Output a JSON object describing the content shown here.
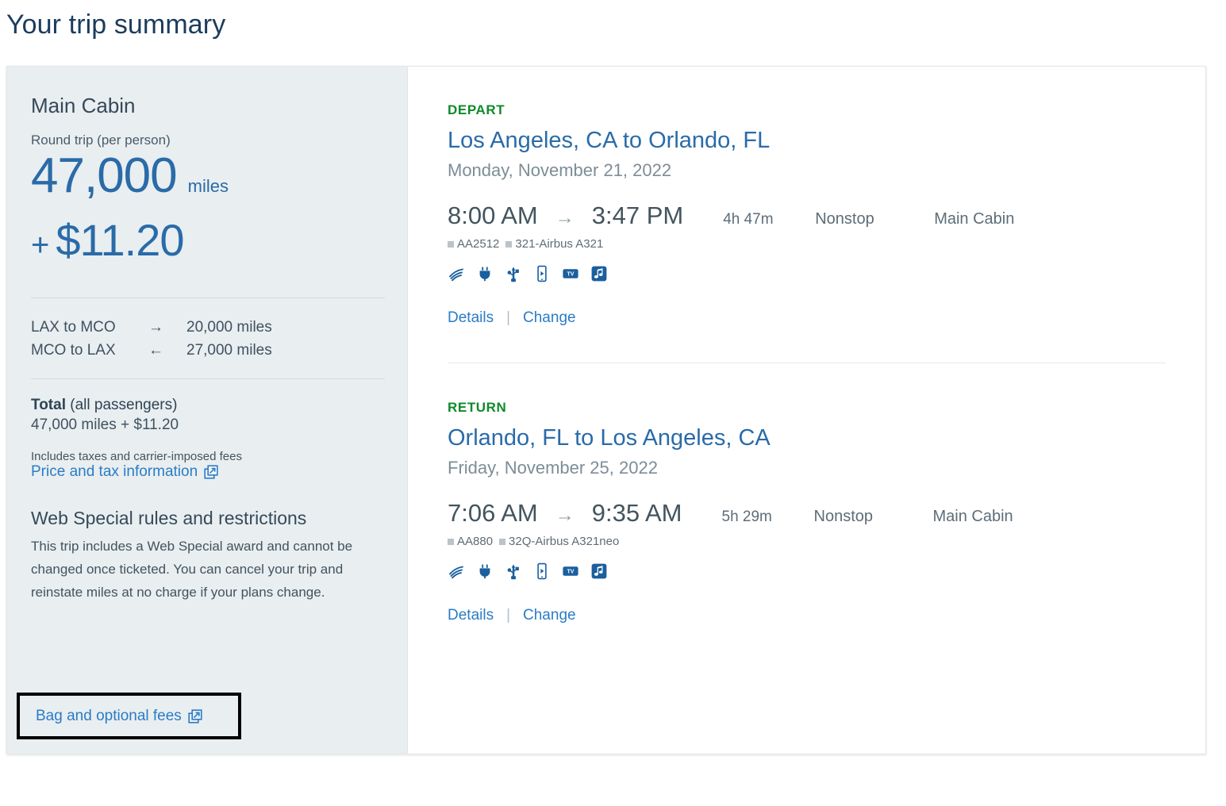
{
  "page": {
    "title": "Your trip summary"
  },
  "summary": {
    "cabin": "Main Cabin",
    "round_trip_label": "Round trip (per person)",
    "miles_value": "47,000",
    "miles_unit": "miles",
    "cash_plus": "+",
    "cash_value": "$11.20",
    "legs": [
      {
        "route": "LAX to MCO",
        "arrow": "→",
        "miles": "20,000 miles"
      },
      {
        "route": "MCO to LAX",
        "arrow": "←",
        "miles": "27,000 miles"
      }
    ],
    "total_label_bold": "Total",
    "total_label_rest": " (all passengers)",
    "total_amount": "47,000 miles + $11.20",
    "includes_fees": "Includes taxes and carrier-imposed fees",
    "price_tax_link": "Price and tax information",
    "rules_title": "Web Special rules and restrictions",
    "rules_text": "This trip includes a Web Special award and cannot be changed once ticketed. You can cancel your trip and reinstate miles at no charge if your plans change.",
    "bag_fees_link": "Bag and optional fees"
  },
  "flights": [
    {
      "segment_label": "DEPART",
      "route": "Los Angeles, CA to Orlando, FL",
      "date": "Monday, November 21, 2022",
      "depart_time": "8:00 AM",
      "arrow": "→",
      "arrive_time": "3:47 PM",
      "duration": "4h 47m",
      "stops": "Nonstop",
      "cabin": "Main Cabin",
      "flight_number": "AA2512",
      "aircraft": "321-Airbus A321",
      "amenities": [
        "wifi-icon",
        "power-outlet-icon",
        "usb-icon",
        "mobile-device-icon",
        "tv-icon",
        "music-icon"
      ],
      "details_label": "Details",
      "change_label": "Change"
    },
    {
      "segment_label": "RETURN",
      "route": "Orlando, FL to Los Angeles, CA",
      "date": "Friday, November 25, 2022",
      "depart_time": "7:06 AM",
      "arrow": "→",
      "arrive_time": "9:35 AM",
      "duration": "5h 29m",
      "stops": "Nonstop",
      "cabin": "Main Cabin",
      "flight_number": "AA880",
      "aircraft": "32Q-Airbus A321neo",
      "amenities": [
        "wifi-icon",
        "power-outlet-icon",
        "usb-icon",
        "mobile-device-icon",
        "tv-icon",
        "music-icon"
      ],
      "details_label": "Details",
      "change_label": "Change"
    }
  ],
  "colors": {
    "accent_blue": "#2a6ba8",
    "link_blue": "#2a7cc7",
    "segment_green": "#0f8a2a",
    "sidebar_bg": "#e9eef0",
    "title_navy": "#1c3c5c"
  }
}
